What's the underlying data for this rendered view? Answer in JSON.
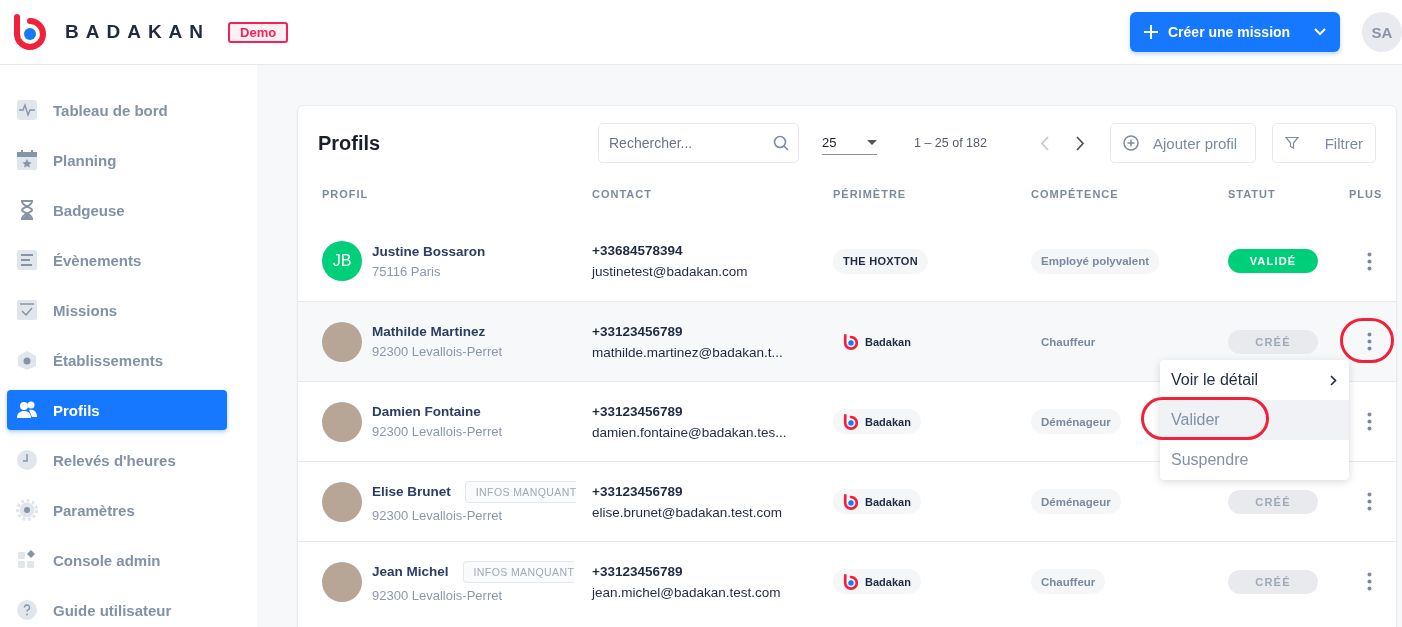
{
  "header": {
    "brand": "BADAKAN",
    "badge": "Demo",
    "create_button": "Créer une mission",
    "user_initials": "SA"
  },
  "sidebar": {
    "items": [
      {
        "label": "Tableau de bord",
        "selected": false
      },
      {
        "label": "Planning",
        "selected": false
      },
      {
        "label": "Badgeuse",
        "selected": false
      },
      {
        "label": "Évènements",
        "selected": false
      },
      {
        "label": "Missions",
        "selected": false
      },
      {
        "label": "Établissements",
        "selected": false
      },
      {
        "label": "Profils",
        "selected": true
      },
      {
        "label": "Relevés d'heures",
        "selected": false
      },
      {
        "label": "Paramètres",
        "selected": false
      },
      {
        "label": "Console admin",
        "selected": false
      },
      {
        "label": "Guide utilisateur",
        "selected": false
      }
    ]
  },
  "profiles": {
    "title": "Profils",
    "search": {
      "placeholder": "Rechercher..."
    },
    "page_size": "25",
    "range": "1 – 25 of 182",
    "prev_disabled": true,
    "add_button": "Ajouter profil",
    "filter_button": "Filtrer",
    "columns": [
      "PROFIL",
      "CONTACT",
      "PÉRIMÈTRE",
      "COMPÉTENCE",
      "STATUT",
      "PLUS"
    ],
    "rows": [
      {
        "name": "Justine Bossaron",
        "location": "75116 Paris",
        "avatar": {
          "kind": "initials",
          "text": "JB"
        },
        "phone": "+33684578394",
        "email": "justinetest@badakan.com",
        "perimeter": {
          "kind": "text",
          "label": "THE HOXTON"
        },
        "skill": "Employé polyvalent",
        "status": {
          "kind": "validated",
          "label": "VALIDÉ"
        },
        "hovered": false,
        "menu_circled": false
      },
      {
        "name": "Mathilde Martinez",
        "location": "92300 Levallois-Perret",
        "avatar": {
          "kind": "photo"
        },
        "phone": "+33123456789",
        "email": "mathilde.martinez@badakan.t...",
        "perimeter": {
          "kind": "brand",
          "label": "Badakan"
        },
        "skill": "Chauffeur",
        "status": {
          "kind": "created",
          "label": "CRÉÉ"
        },
        "hovered": true,
        "menu_circled": true,
        "menu": {
          "items": [
            {
              "label": "Voir le détail",
              "kind": "submenu",
              "highlighted": false,
              "circled": false
            },
            {
              "label": "Valider",
              "kind": "action",
              "highlighted": true,
              "circled": true
            },
            {
              "label": "Suspendre",
              "kind": "action",
              "highlighted": false,
              "circled": false
            }
          ]
        }
      },
      {
        "name": "Damien Fontaine",
        "location": "92300 Levallois-Perret",
        "avatar": {
          "kind": "photo"
        },
        "phone": "+33123456789",
        "email": "damien.fontaine@badakan.tes...",
        "perimeter": {
          "kind": "brand",
          "label": "Badakan"
        },
        "skill": "Déménageur",
        "hovered": false,
        "menu_circled": false
      },
      {
        "name": "Elise Brunet",
        "tag": "INFOS MANQUANT",
        "location": "92300 Levallois-Perret",
        "avatar": {
          "kind": "photo"
        },
        "phone": "+33123456789",
        "email": "elise.brunet@badakan.test.com",
        "perimeter": {
          "kind": "brand",
          "label": "Badakan"
        },
        "skill": "Déménageur",
        "status": {
          "kind": "created",
          "label": "CRÉÉ"
        },
        "hovered": false,
        "menu_circled": false
      },
      {
        "name": "Jean Michel",
        "tag": "INFOS MANQUANT",
        "location": "92300 Levallois-Perret",
        "avatar": {
          "kind": "photo"
        },
        "phone": "+33123456789",
        "email": "jean.michel@badakan.test.com",
        "perimeter": {
          "kind": "brand",
          "label": "Badakan"
        },
        "skill": "Chauffeur",
        "status": {
          "kind": "created",
          "label": "CRÉÉ"
        },
        "hovered": false,
        "menu_circled": false
      }
    ]
  }
}
